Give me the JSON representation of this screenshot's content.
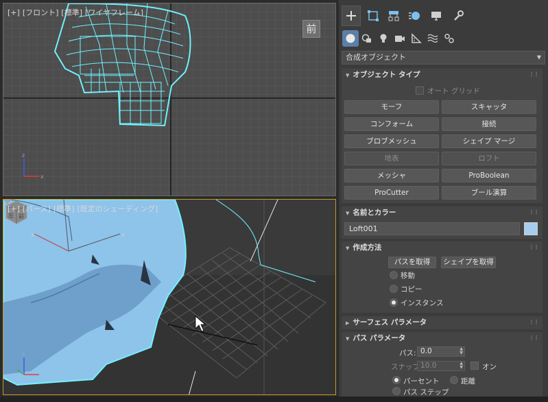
{
  "viewports": {
    "front": {
      "label": [
        "[+]",
        "[フロント]",
        "[標準]",
        "[ワイヤフレーム]"
      ],
      "tag": "前"
    },
    "perspective": {
      "label": [
        "[+]",
        "[パース]",
        "[標準]",
        "[既定のシェーディング]"
      ],
      "cube_text": "左 前"
    }
  },
  "panel": {
    "dropdown": "合成オブジェクト",
    "object_type": {
      "title": "オブジェクト タイプ",
      "auto_grid": "オート グリッド",
      "buttons": [
        "モーフ",
        "スキャッタ",
        "コンフォーム",
        "接続",
        "ブロブメッシュ",
        "シェイプ マージ",
        "地表",
        "ロフト",
        "メッシャ",
        "ProBoolean",
        "ProCutter",
        "ブール演算"
      ]
    },
    "name_color": {
      "title": "名前とカラー",
      "name": "Loft001",
      "color": "#a6cdf0"
    },
    "creation_method": {
      "title": "作成方法",
      "get_path": "パスを取得",
      "get_shape": "シェイプを取得",
      "options": [
        "移動",
        "コピー",
        "インスタンス"
      ],
      "selected": "インスタンス"
    },
    "surface_params": {
      "title": "サーフェス パラメータ"
    },
    "path_params": {
      "title": "パス パラメータ",
      "path_label": "パス:",
      "path_value": "0.0",
      "snap_label": "スナップ:",
      "snap_value": "10.0",
      "on_label": "オン",
      "percent": "パーセント",
      "distance": "距離",
      "path_steps": "パス ステップ"
    }
  },
  "colors": {
    "accent": "#5c7fa8",
    "wire": "#6ff3ff",
    "surface": "#8ec3ea",
    "viewport_active_border": "#c79a2a"
  }
}
